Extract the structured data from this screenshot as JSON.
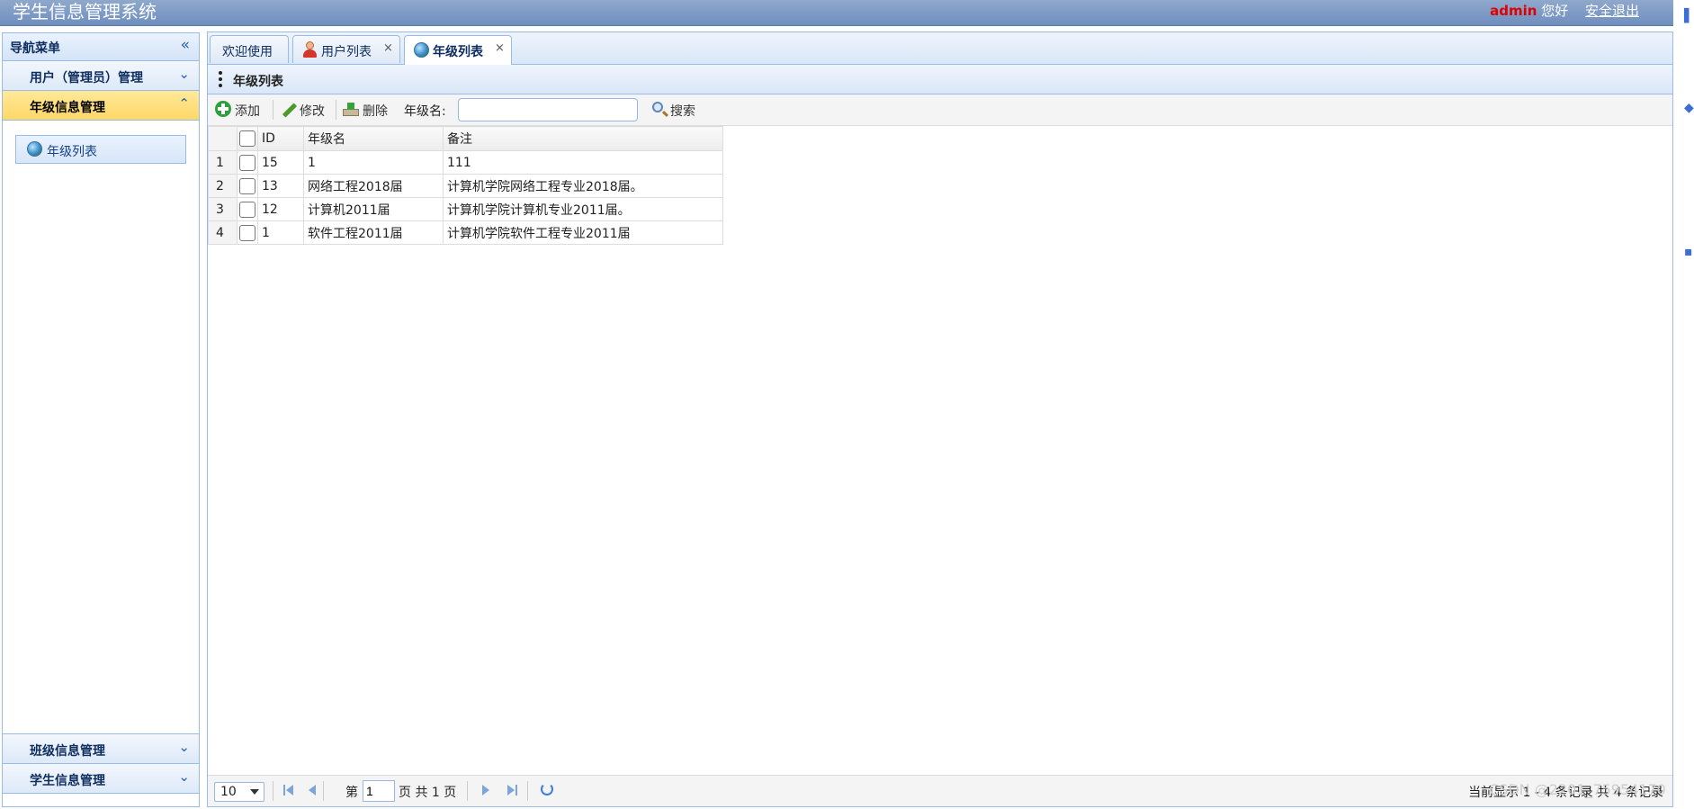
{
  "header": {
    "title": "学生信息管理系统",
    "username": "admin",
    "greeting": "您好",
    "logout_label": "安全退出"
  },
  "sidebar": {
    "title": "导航菜单",
    "collapse_icon": "double-chevron-left-icon",
    "sections": [
      {
        "label": "用户（管理员）管理",
        "expanded": false
      },
      {
        "label": "年级信息管理",
        "expanded": true,
        "items": [
          {
            "label": "年级列表",
            "icon": "globe-icon"
          }
        ]
      },
      {
        "label": "班级信息管理",
        "expanded": false
      },
      {
        "label": "学生信息管理",
        "expanded": false
      }
    ]
  },
  "tabs": [
    {
      "label": "欢迎使用",
      "closable": false,
      "active": false
    },
    {
      "label": "用户列表",
      "closable": true,
      "active": false,
      "icon": "user-icon"
    },
    {
      "label": "年级列表",
      "closable": true,
      "active": true,
      "icon": "globe-icon"
    }
  ],
  "tab_close_glyph": "×",
  "panel": {
    "title": "年级列表"
  },
  "toolbar": {
    "add_label": "添加",
    "edit_label": "修改",
    "delete_label": "删除",
    "filter_label": "年级名:",
    "search_value": "",
    "search_label": "搜索"
  },
  "grid": {
    "columns": [
      "ID",
      "年级名",
      "备注"
    ],
    "rows": [
      {
        "num": "1",
        "id": "15",
        "name": "1",
        "remark": "111"
      },
      {
        "num": "2",
        "id": "13",
        "name": "网络工程2018届",
        "remark": "计算机学院网络工程专业2018届。"
      },
      {
        "num": "3",
        "id": "12",
        "name": "计算机2011届",
        "remark": "计算机学院计算机专业2011届。"
      },
      {
        "num": "4",
        "id": "1",
        "name": "软件工程2011届",
        "remark": "计算机学院软件工程专业2011届"
      }
    ]
  },
  "pager": {
    "page_size": "10",
    "page_prefix": "第",
    "current_page": "1",
    "page_suffix": "页 共 1 页",
    "info": "当前显示 1 - 4 条记录 共 4 条记录"
  },
  "watermark": "CSDN @2201_75954170",
  "colors": {
    "header": "#7b97c5",
    "active_section": "#ffd766",
    "username": "#e00000"
  }
}
